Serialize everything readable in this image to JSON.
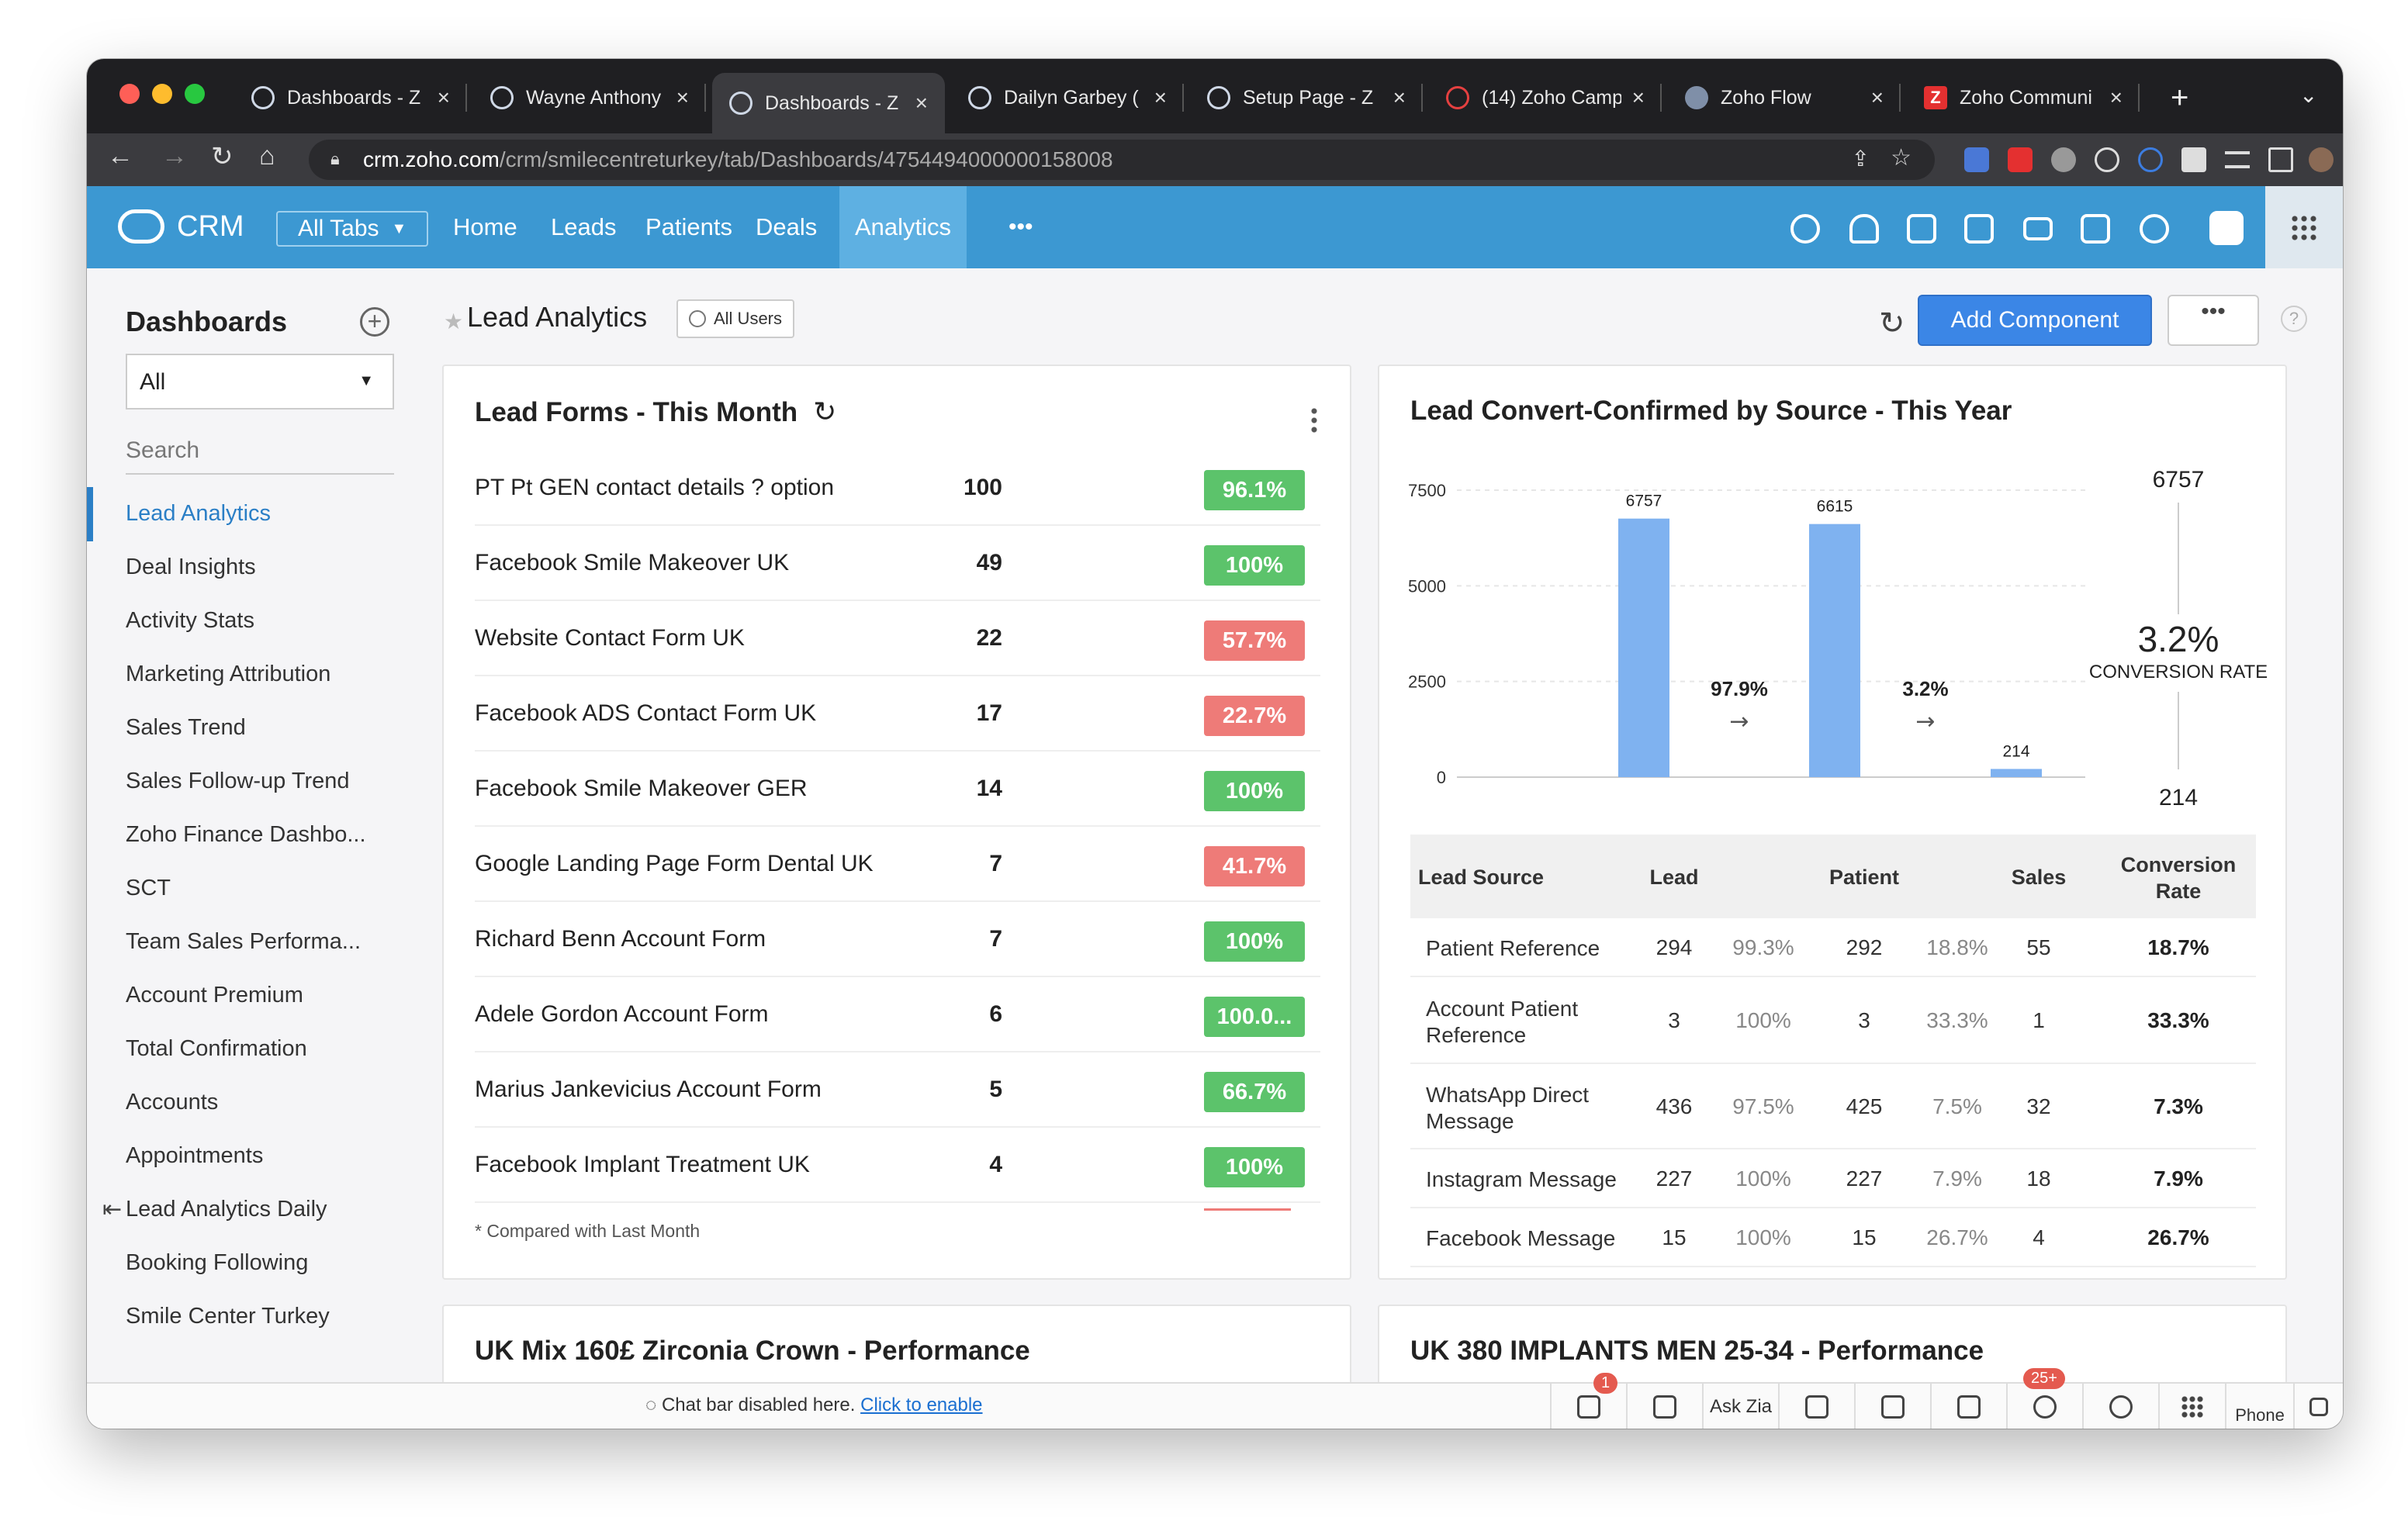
{
  "browser": {
    "tabs": [
      {
        "title": "Dashboards - Z",
        "icon": "zoho-crm-icon",
        "active": false
      },
      {
        "title": "Wayne Anthony",
        "icon": "zoho-crm-icon",
        "active": false
      },
      {
        "title": "Dashboards - Z",
        "icon": "zoho-crm-icon",
        "active": true
      },
      {
        "title": "Dailyn Garbey (",
        "icon": "zoho-crm-icon",
        "active": false
      },
      {
        "title": "Setup Page - Z",
        "icon": "zoho-crm-icon",
        "active": false
      },
      {
        "title": "(14) Zoho Camp",
        "icon": "zoho-campaigns-icon",
        "active": false
      },
      {
        "title": "Zoho Flow",
        "icon": "zoho-flow-icon",
        "active": false
      },
      {
        "title": "Zoho Communi",
        "icon": "zoho-z-icon",
        "active": false
      }
    ],
    "url_host": "crm.zoho.com",
    "url_path": "/crm/smilecentreturkey/tab/Dashboards/4754494000000158008"
  },
  "crm": {
    "logo": "CRM",
    "all_tabs": "All Tabs",
    "nav": [
      "Home",
      "Leads",
      "Patients",
      "Deals",
      "Analytics"
    ],
    "active_nav": "Analytics",
    "more": "•••"
  },
  "sidebar": {
    "title": "Dashboards",
    "filter": "All",
    "search_placeholder": "Search",
    "items": [
      "Lead Analytics",
      "Deal Insights",
      "Activity Stats",
      "Marketing Attribution",
      "Sales Trend",
      "Sales Follow-up Trend",
      "Zoho Finance Dashbo...",
      "SCT",
      "Team Sales Performa...",
      "Account Premium",
      "Total Confirmation",
      "Accounts",
      "Appointments",
      "Lead Analytics Daily",
      "Booking Following",
      "Smile Center Turkey"
    ],
    "active": "Lead Analytics"
  },
  "header": {
    "title": "Lead Analytics",
    "users": "All Users",
    "add_component": "Add Component",
    "more": "•••",
    "help": "?"
  },
  "lead_forms": {
    "title": "Lead Forms - This Month",
    "rows": [
      {
        "name": "PT Pt GEN contact details ? option",
        "value": "100",
        "change": "96.1%",
        "status": "up"
      },
      {
        "name": "Facebook Smile Makeover UK",
        "value": "49",
        "change": "100%",
        "status": "up"
      },
      {
        "name": "Website Contact Form UK",
        "value": "22",
        "change": "57.7%",
        "status": "down"
      },
      {
        "name": "Facebook ADS Contact Form UK",
        "value": "17",
        "change": "22.7%",
        "status": "down"
      },
      {
        "name": "Facebook Smile Makeover GER",
        "value": "14",
        "change": "100%",
        "status": "up"
      },
      {
        "name": "Google Landing Page Form Dental UK",
        "value": "7",
        "change": "41.7%",
        "status": "down"
      },
      {
        "name": "Richard Benn Account Form",
        "value": "7",
        "change": "100%",
        "status": "up"
      },
      {
        "name": "Adele Gordon Account Form",
        "value": "6",
        "change": "100.0...",
        "status": "up"
      },
      {
        "name": "Marius Jankevicius Account Form",
        "value": "5",
        "change": "66.7%",
        "status": "up"
      },
      {
        "name": "Facebook Implant Treatment UK",
        "value": "4",
        "change": "100%",
        "status": "up"
      }
    ],
    "note": "* Compared with Last Month"
  },
  "conversion": {
    "title": "Lead Convert-Confirmed by Source - This Year",
    "summary_top": "6757",
    "summary_rate": "3.2%",
    "summary_label": "CONVERSION RATE",
    "summary_bottom": "214",
    "table_headers": [
      "Lead Source",
      "Lead",
      "Patient",
      "Sales",
      "Conversion Rate"
    ],
    "rows": [
      {
        "source": "Patient Reference",
        "lead": "294",
        "lead_pct": "99.3%",
        "patient": "292",
        "patient_pct": "18.8%",
        "sales": "55",
        "rate": "18.7%"
      },
      {
        "source": "Account Patient Reference",
        "lead": "3",
        "lead_pct": "100%",
        "patient": "3",
        "patient_pct": "33.3%",
        "sales": "1",
        "rate": "33.3%"
      },
      {
        "source": "WhatsApp Direct Message",
        "lead": "436",
        "lead_pct": "97.5%",
        "patient": "425",
        "patient_pct": "7.5%",
        "sales": "32",
        "rate": "7.3%"
      },
      {
        "source": "Instagram Message",
        "lead": "227",
        "lead_pct": "100%",
        "patient": "227",
        "patient_pct": "7.9%",
        "sales": "18",
        "rate": "7.9%"
      },
      {
        "source": "Facebook Message",
        "lead": "15",
        "lead_pct": "100%",
        "patient": "15",
        "patient_pct": "26.7%",
        "sales": "4",
        "rate": "26.7%"
      }
    ]
  },
  "chart_data": {
    "type": "bar",
    "categories": [
      "Lead",
      "Patient",
      "Sales"
    ],
    "values": [
      6757,
      6615,
      214
    ],
    "value_labels": [
      "6757",
      "6615",
      "214"
    ],
    "stage_rates": [
      "97.9%",
      "3.2%"
    ],
    "yticks": [
      0,
      2500,
      5000,
      7500
    ],
    "ytick_labels": [
      "0",
      "2500",
      "5000",
      "7500"
    ],
    "ylim": [
      0,
      7500
    ],
    "grid": true,
    "bar_color": "#7fb2f0"
  },
  "panels": {
    "bottom_left": "UK Mix 160£ Zirconia Crown - Performance",
    "bottom_right": "UK 380 IMPLANTS MEN 25-34 - Performance"
  },
  "footer": {
    "chat_msg": "Chat bar disabled here.",
    "chat_link": "Click to enable",
    "ask_zia": "Ask Zia",
    "phone": "Phone",
    "badge_1": "1",
    "badge_2": "25+"
  },
  "colors": {
    "crm_blue": "#3c98d2",
    "green": "#5cc36b",
    "red": "#ee7b78",
    "accent": "#3b86e6"
  }
}
